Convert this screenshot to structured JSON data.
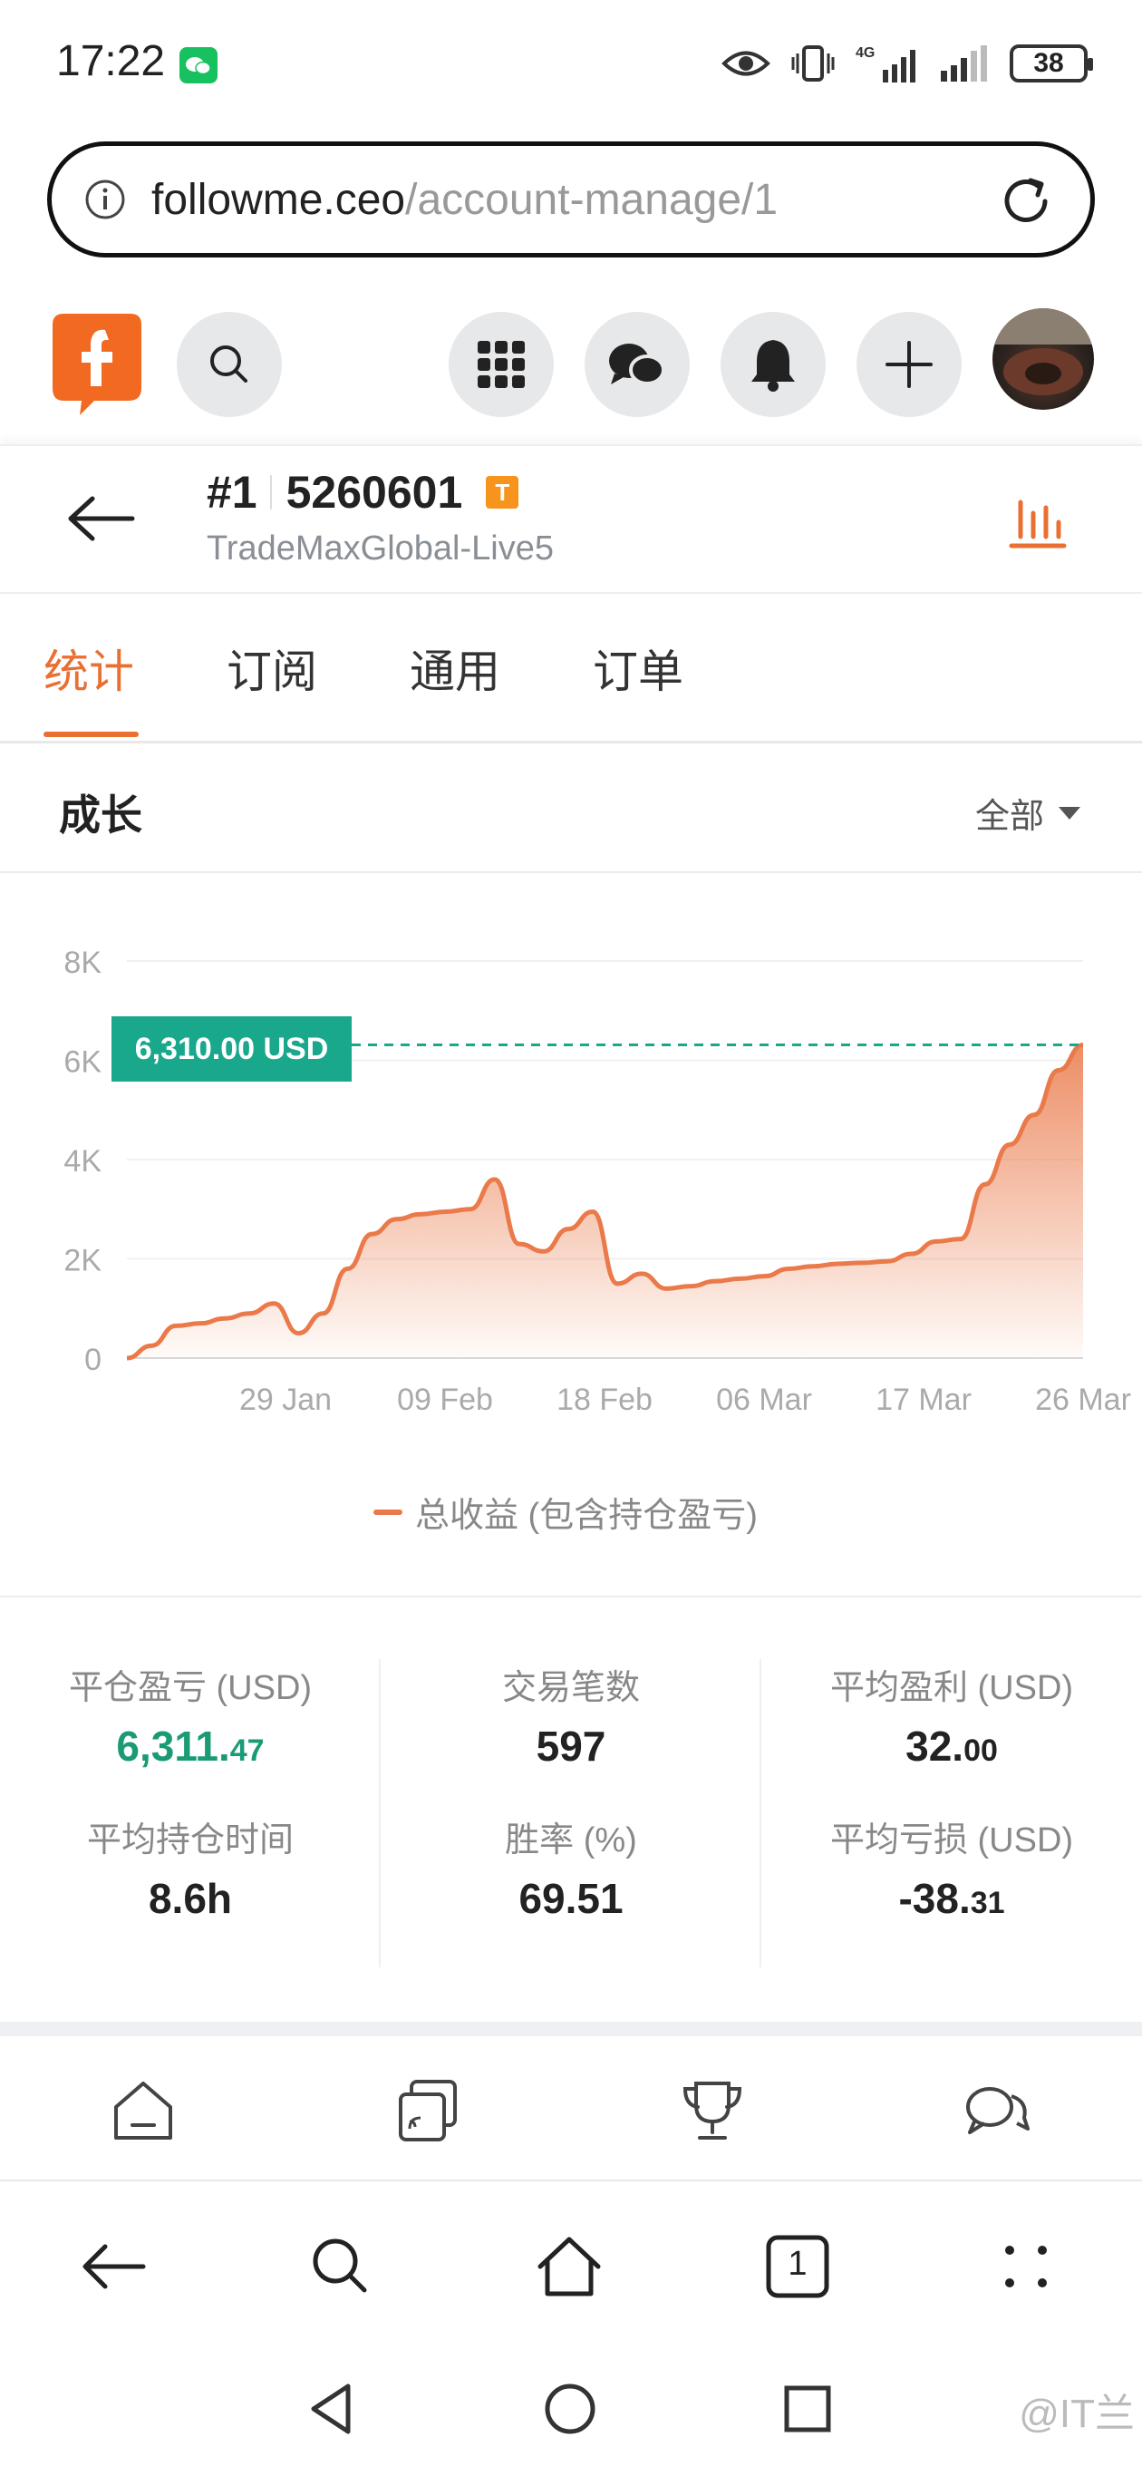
{
  "status_bar": {
    "time": "17:22",
    "network": "4G",
    "battery": "38"
  },
  "url_bar": {
    "domain": "followme.ceo",
    "path": "/account-manage/1"
  },
  "account": {
    "number": "#1",
    "id": "5260601",
    "badge": "T",
    "server": "TradeMaxGlobal-Live5"
  },
  "tabs": [
    {
      "label": "统计",
      "active": true
    },
    {
      "label": "订阅",
      "active": false
    },
    {
      "label": "通用",
      "active": false
    },
    {
      "label": "订单",
      "active": false
    }
  ],
  "section": {
    "title": "成长",
    "filter": "全部"
  },
  "chart_data": {
    "type": "area",
    "x_tick_labels": [
      "29 Jan",
      "09 Feb",
      "18 Feb",
      "06 Mar",
      "17 Mar",
      "26 Mar"
    ],
    "y_tick_labels": [
      "8K",
      "6K",
      "4K",
      "2K",
      "0"
    ],
    "ylim": [
      0,
      8000
    ],
    "current_value_label": "6,310.00 USD",
    "current_value": 6310,
    "series": [
      {
        "name": "总收益 (包含持仓盈亏)",
        "color": "#ea7a4a",
        "values": [
          0,
          250,
          650,
          700,
          800,
          900,
          1100,
          500,
          900,
          1800,
          2500,
          2800,
          2900,
          2950,
          3000,
          3600,
          2300,
          2150,
          2600,
          2950,
          1500,
          1700,
          1400,
          1450,
          1550,
          1600,
          1650,
          1800,
          1850,
          1900,
          1920,
          1950,
          2100,
          2350,
          2400,
          3500,
          4300,
          4900,
          5800,
          6310
        ]
      }
    ],
    "grid": true,
    "legend_position": "bottom"
  },
  "stats": [
    {
      "label": "平仓盈亏 (USD)",
      "value_main": "6,311.",
      "value_small": "47",
      "color": "#1a9a75"
    },
    {
      "label": "交易笔数",
      "value_main": "597",
      "value_small": ""
    },
    {
      "label": "平均盈利 (USD)",
      "value_main": "32.",
      "value_small": "00"
    },
    {
      "label": "平均持仓时间",
      "value_main": "8.6h",
      "value_small": ""
    },
    {
      "label": "胜率 (%)",
      "value_main": "69.51",
      "value_small": ""
    },
    {
      "label": "平均亏损 (USD)",
      "value_main": "-38.",
      "value_small": "31"
    }
  ],
  "browser_nav": {
    "tab_count": "1"
  },
  "watermark": "@IT兰",
  "colors": {
    "accent": "#ea6f33",
    "green": "#1aa88d",
    "line": "#ea7a4a"
  }
}
